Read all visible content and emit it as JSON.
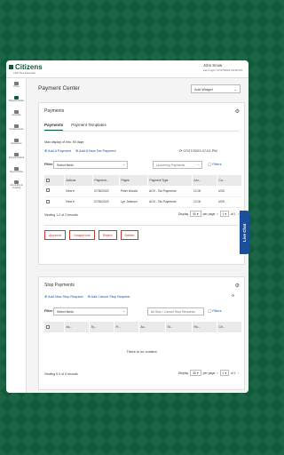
{
  "header": {
    "brand": "Citizens",
    "tagline": "Cash Flow Essentials",
    "user_name": "John Snow",
    "last_login": "Last Login: 07/27/2023 09:36 PM"
  },
  "sidebar": {
    "items": [
      {
        "label": "Home",
        "icon": "home-icon"
      },
      {
        "label": "Payment Center",
        "icon": "payment-icon",
        "active": true
      },
      {
        "label": "Accounts",
        "icon": "accounts-icon"
      },
      {
        "label": "Contact Center",
        "icon": "contact-icon"
      },
      {
        "label": "Employees",
        "icon": "employees-icon"
      },
      {
        "label": "Approve & Send",
        "icon": "approve-icon"
      },
      {
        "label": "Payroll Online",
        "icon": "payroll-icon"
      },
      {
        "label": "Accounting & Invoicing",
        "icon": "accounting-icon"
      }
    ]
  },
  "main": {
    "title": "Payment Center",
    "add_widget": "Add Widget"
  },
  "payments": {
    "title": "Payments",
    "tabs": [
      "Payments",
      "Payment Templates"
    ],
    "max_display": "Max display of info: 90 days",
    "add_payment": "Add A Payment",
    "add_tax_payment": "Add A New Tax Payment",
    "refresh_time": "07/27/2023 07:01 PM",
    "filter_label": "Filter",
    "filter_placeholder": "Select fields",
    "filter_type": "Upcoming Payments",
    "filters_link": "Filters",
    "columns": [
      "",
      "Actions",
      "Payment...",
      "Payee",
      "Payment Type",
      "Am...",
      "Cu..."
    ],
    "rows": [
      {
        "action": "View",
        "date": "07/30/2023",
        "payee": "Peter Woods",
        "type": "ACH - Tax Payments",
        "amount": "12.00",
        "currency": "USD"
      },
      {
        "action": "View",
        "date": "07/30/2023",
        "payee": "Lyn Johnson",
        "type": "ACH - Tax Payments",
        "amount": "12.00",
        "currency": "USD"
      }
    ],
    "pager_text": "Viewing 1-2 of 2 records",
    "display_label": "Display",
    "display_value": "50",
    "per_page": "per page",
    "page_value": "1",
    "of_pages": "of 1",
    "buttons": [
      "Approve",
      "Unapprove",
      "Reject",
      "Delete"
    ]
  },
  "stop_payments": {
    "title": "Stop Payments",
    "add_new": "Add New Stop Request",
    "add_cancel": "Add Cancel Stop Request",
    "filter_label": "Filter",
    "filter_placeholder": "Select fields",
    "filter_type": "All Stop / Cancel Stop Requests",
    "filters_link": "Filters",
    "columns": [
      "",
      "Ac...",
      "Ty...",
      "Fr...",
      "Ac...",
      "St...",
      "Ra...",
      "Ch..."
    ],
    "empty_text": "There is no content",
    "pager_text": "Viewing 0-0 of 0 records",
    "display_label": "Display",
    "display_value": "50",
    "per_page": "per page",
    "page_value": "1",
    "of_pages": "of 1"
  },
  "live_chat": "Live Chat",
  "colors": {
    "brand": "#0f5b3a",
    "link": "#1a4f9c",
    "danger": "#c0392b"
  }
}
